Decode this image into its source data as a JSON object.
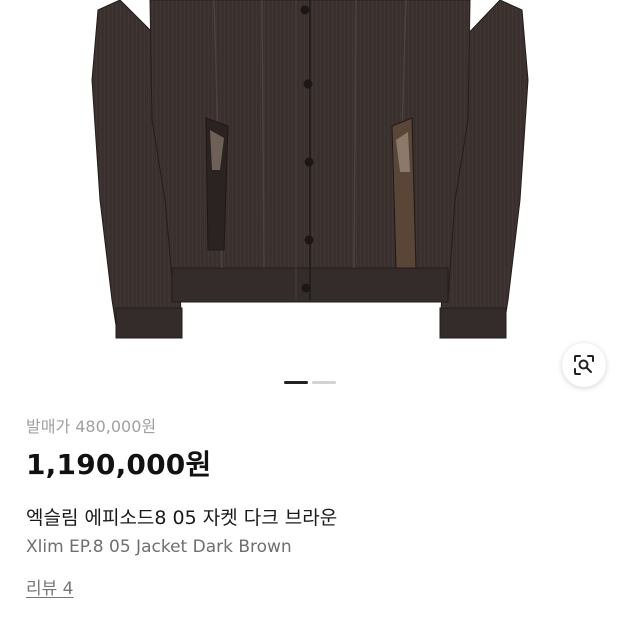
{
  "product": {
    "image_alt": "Xlim EP.8 05 Jacket Dark Brown photo",
    "original_price": "발매가 480,000원",
    "price": "1,190,000원",
    "name_ko": "엑슬림 에피소드8 05 자켓 다크 브라운",
    "name_en": "Xlim EP.8 05 Jacket Dark Brown",
    "review_link": "리뷰 4"
  },
  "gallery": {
    "total_slides": 2,
    "active_slide": 1
  },
  "icons": {
    "lens": "image-search-icon"
  },
  "colors": {
    "jacket": "#3a312f",
    "jacket_dark": "#2a2322",
    "pocket_lining": "#5a4636",
    "price_text": "#111111",
    "muted_text": "#a0a0a0"
  }
}
